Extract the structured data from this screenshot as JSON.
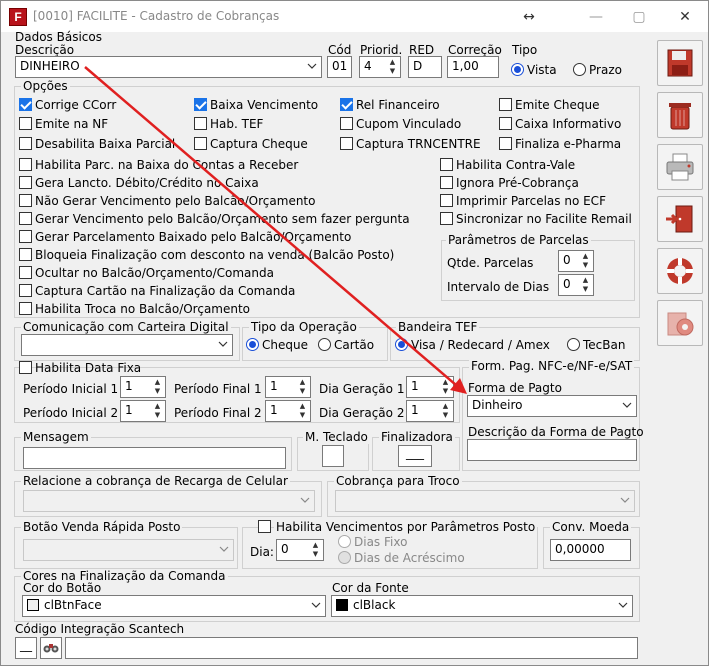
{
  "window": {
    "title": "[0010] FACILITE - Cadastro de Cobranças",
    "restore_glyph": "↔",
    "min": "—",
    "max": "▢",
    "close": "✕",
    "icon_letter": "F"
  },
  "dados": {
    "group": "Dados Básicos",
    "descricao_label": "Descrição",
    "descricao_value": "DINHEIRO",
    "cod_label": "Cód",
    "cod_value": "01",
    "prioridade_label": "Priorid.",
    "prioridade_value": "4",
    "red_label": "RED",
    "red_value": "D",
    "correcao_label": "Correção",
    "correcao_value": "1,00",
    "tipo_label": "Tipo",
    "tipo_vista": "Vista",
    "tipo_prazo": "Prazo"
  },
  "opcoes": {
    "group": "Opções",
    "grid": [
      {
        "label": "Corrige CCorr",
        "checked": true
      },
      {
        "label": "Baixa Vencimento",
        "checked": true
      },
      {
        "label": "Rel Financeiro",
        "checked": true
      },
      {
        "label": "Emite Cheque",
        "checked": false
      },
      {
        "label": "Emite na NF",
        "checked": false
      },
      {
        "label": "Hab. TEF",
        "checked": false
      },
      {
        "label": "Cupom Vinculado",
        "checked": false
      },
      {
        "label": "Caixa Informativo",
        "checked": false
      },
      {
        "label": "Desabilita Baixa Parcial",
        "checked": false
      },
      {
        "label": "Captura Cheque",
        "checked": false
      },
      {
        "label": "Captura TRNCENTRE",
        "checked": false
      },
      {
        "label": "Finaliza e-Pharma",
        "checked": false
      }
    ],
    "left_list": [
      "Habilita Parc. na Baixa do Contas a Receber",
      "Gera Lancto. Débito/Crédito no Caixa",
      "Não Gerar Vencimento pelo Balcão/Orçamento",
      "Gerar Vencimento pelo Balcão/Orçamento sem fazer pergunta",
      "Gerar Parcelamento Baixado pelo Balcão/Orçamento",
      "Bloqueia Finalização com desconto na venda (Balcão Posto)",
      "Ocultar no Balcão/Orçamento/Comanda",
      "Captura Cartão na Finalização da Comanda",
      "Habilita Troca no Balcão/Orçamento"
    ],
    "right_list": [
      "Habilita Contra-Vale",
      "Ignora Pré-Cobrança",
      "Imprimir Parcelas no ECF",
      "Sincronizar no Facilite Remail"
    ],
    "parcelas_group": "Parâmetros de Parcelas",
    "qtde_label": "Qtde. Parcelas",
    "qtde_value": "0",
    "intervalo_label": "Intervalo de Dias",
    "intervalo_value": "0"
  },
  "comunicacao": {
    "label": "Comunicação com Carteira Digital",
    "value": ""
  },
  "tipo_operacao": {
    "label": "Tipo da Operação",
    "cheque": "Cheque",
    "cartao": "Cartão"
  },
  "bandeira": {
    "label": "Bandeira TEF",
    "visa": "Visa / Redecard / Amex",
    "tecban": "TecBan"
  },
  "data_fixa": {
    "label": "Habilita Data Fixa",
    "pi1": "Período Inicial 1",
    "pf1": "Período Final 1",
    "dg1": "Dia Geração 1",
    "pi2": "Período Inicial 2",
    "pf2": "Período Final 2",
    "dg2": "Dia Geração 2",
    "v": "1"
  },
  "nfce": {
    "group": "Form. Pag. NFC-e/NF-e/SAT",
    "forma_label": "Forma de Pagto",
    "forma_value": "Dinheiro",
    "desc_label": "Descrição da Forma de Pagto",
    "desc_value": ""
  },
  "mensagem": {
    "label": "Mensagem",
    "teclado": "M. Teclado",
    "finalizadora": "Finalizadora",
    "finalizadora_value": "___"
  },
  "recarga": {
    "label": "Relacione a cobrança de Recarga de Celular"
  },
  "troco": {
    "label": "Cobrança para Troco"
  },
  "botao_rapida": {
    "label": "Botão Venda Rápida Posto"
  },
  "vencimentos": {
    "label": "Habilita Vencimentos por Parâmetros Posto",
    "dia_label": "Dia:",
    "dia_value": "0",
    "dias_fixo": "Dias Fixo",
    "dias_acrescimo": "Dias de Acréscimo"
  },
  "moeda": {
    "label": "Conv. Moeda",
    "value": "0,00000"
  },
  "cores": {
    "group": "Cores na Finalização da Comanda",
    "botao_label": "Cor do Botão",
    "botao_value": "clBtnFace",
    "botao_color": "#f0f0f0",
    "fonte_label": "Cor da Fonte",
    "fonte_value": "clBlack",
    "fonte_color": "#000000"
  },
  "scantech": {
    "label": "Código Integração Scantech",
    "btn1": "__",
    "value": ""
  },
  "side_buttons": [
    "save-icon",
    "trash-icon",
    "printer-icon",
    "exit-door-icon",
    "lifebuoy-help-icon",
    "settings-gear-icon"
  ],
  "annotation_color": "#e02020"
}
